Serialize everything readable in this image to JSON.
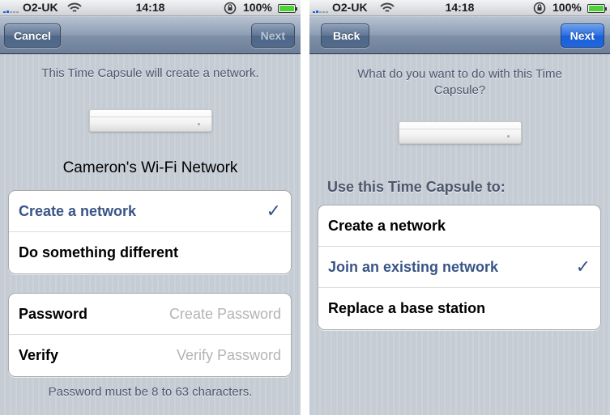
{
  "status_bar": {
    "carrier": "O2-UK",
    "time": "14:18",
    "battery_percent": "100%"
  },
  "screen1": {
    "nav": {
      "left_button": "Cancel",
      "right_button": "Next",
      "right_enabled": false
    },
    "intro": "This Time Capsule will create a network.",
    "network_name": "Cameron's Wi-Fi Network",
    "options": [
      {
        "label": "Create a network",
        "selected": true
      },
      {
        "label": "Do something different",
        "selected": false
      }
    ],
    "password_fields": [
      {
        "label": "Password",
        "placeholder": "Create Password",
        "value": ""
      },
      {
        "label": "Verify",
        "placeholder": "Verify Password",
        "value": ""
      }
    ],
    "footer": "Password must be 8 to 63 characters."
  },
  "screen2": {
    "nav": {
      "left_button": "Back",
      "right_button": "Next",
      "right_enabled": true
    },
    "question": "What do you want to do with this Time Capsule?",
    "section_header": "Use this Time Capsule to:",
    "options": [
      {
        "label": "Create a network",
        "selected": false
      },
      {
        "label": "Join an existing network",
        "selected": true
      },
      {
        "label": "Replace a base station",
        "selected": false
      }
    ]
  },
  "icons": {
    "checkmark": "✓",
    "signal": "signal-bars-icon",
    "wifi": "wifi-icon",
    "rotation_lock": "rotation-lock-icon",
    "battery": "battery-icon"
  },
  "colors": {
    "selected_text": "#385487",
    "battery_fill": "#4fd13a",
    "primary_button": "#2c6fe0",
    "section_text": "#4c566c"
  }
}
